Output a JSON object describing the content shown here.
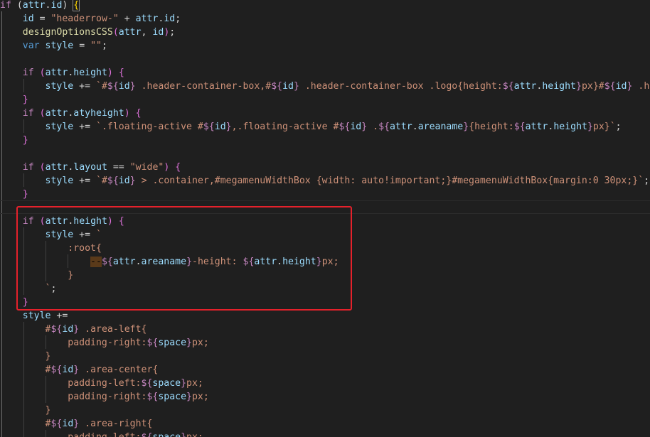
{
  "editor": {
    "colors": {
      "background": "#1f1f1f",
      "keyword": "#569cd6",
      "control": "#c586c0",
      "variable": "#9cdcfe",
      "function": "#dcdcaa",
      "string": "#ce9178",
      "punctuation": "#d4d4d4",
      "brace_level_1": "#ffd700",
      "brace_level_2": "#da70d6",
      "brace_level_3": "#179fff",
      "highlight_box": "#e5212b"
    },
    "lines": [
      [
        [
          "ctl",
          "if"
        ],
        [
          "punc",
          " ("
        ],
        [
          "var",
          "attr"
        ],
        [
          "punc",
          "."
        ],
        [
          "var",
          "id"
        ],
        [
          "punc",
          ") "
        ],
        [
          "brace1",
          "{"
        ]
      ],
      [
        [
          "punc",
          "    "
        ],
        [
          "var",
          "id"
        ],
        [
          "punc",
          " = "
        ],
        [
          "str",
          "\"headerrow-\""
        ],
        [
          "punc",
          " + "
        ],
        [
          "var",
          "attr"
        ],
        [
          "punc",
          "."
        ],
        [
          "var",
          "id"
        ],
        [
          "punc",
          ";"
        ]
      ],
      [
        [
          "punc",
          "    "
        ],
        [
          "fn",
          "designOptionsCSS"
        ],
        [
          "brace2",
          "("
        ],
        [
          "var",
          "attr"
        ],
        [
          "punc",
          ", "
        ],
        [
          "var",
          "id"
        ],
        [
          "brace2",
          ")"
        ],
        [
          "punc",
          ";"
        ]
      ],
      [
        [
          "punc",
          "    "
        ],
        [
          "kw",
          "var"
        ],
        [
          "punc",
          " "
        ],
        [
          "var",
          "style"
        ],
        [
          "punc",
          " = "
        ],
        [
          "str",
          "\"\""
        ],
        [
          "punc",
          ";"
        ]
      ],
      [],
      [
        [
          "punc",
          "    "
        ],
        [
          "ctl",
          "if"
        ],
        [
          "punc",
          " "
        ],
        [
          "brace2",
          "("
        ],
        [
          "var",
          "attr"
        ],
        [
          "punc",
          "."
        ],
        [
          "var",
          "height"
        ],
        [
          "brace2",
          ")"
        ],
        [
          "punc",
          " "
        ],
        [
          "brace2",
          "{"
        ]
      ],
      [
        [
          "punc",
          "        "
        ],
        [
          "var",
          "style"
        ],
        [
          "punc",
          " += "
        ],
        [
          "str",
          "`#"
        ],
        [
          "dollar",
          "${"
        ],
        [
          "var",
          "id"
        ],
        [
          "dollar",
          "}"
        ],
        [
          "str",
          " .header-container-box,#"
        ],
        [
          "dollar",
          "${"
        ],
        [
          "var",
          "id"
        ],
        [
          "dollar",
          "}"
        ],
        [
          "str",
          " .header-container-box .logo{height:"
        ],
        [
          "dollar",
          "${"
        ],
        [
          "var",
          "attr"
        ],
        [
          "punc",
          "."
        ],
        [
          "var",
          "height"
        ],
        [
          "dollar",
          "}"
        ],
        [
          "str",
          "px}#"
        ],
        [
          "dollar",
          "${"
        ],
        [
          "var",
          "id"
        ],
        [
          "dollar",
          "}"
        ],
        [
          "str",
          " .hover"
        ]
      ],
      [
        [
          "punc",
          "    "
        ],
        [
          "brace2",
          "}"
        ]
      ],
      [
        [
          "punc",
          "    "
        ],
        [
          "ctl",
          "if"
        ],
        [
          "punc",
          " "
        ],
        [
          "brace2",
          "("
        ],
        [
          "var",
          "attr"
        ],
        [
          "punc",
          "."
        ],
        [
          "var",
          "atyheight"
        ],
        [
          "brace2",
          ")"
        ],
        [
          "punc",
          " "
        ],
        [
          "brace2",
          "{"
        ]
      ],
      [
        [
          "punc",
          "        "
        ],
        [
          "var",
          "style"
        ],
        [
          "punc",
          " += "
        ],
        [
          "str",
          "`.floating-active #"
        ],
        [
          "dollar",
          "${"
        ],
        [
          "var",
          "id"
        ],
        [
          "dollar",
          "}"
        ],
        [
          "str",
          ",.floating-active #"
        ],
        [
          "dollar",
          "${"
        ],
        [
          "var",
          "id"
        ],
        [
          "dollar",
          "}"
        ],
        [
          "str",
          " ."
        ],
        [
          "dollar",
          "${"
        ],
        [
          "var",
          "attr"
        ],
        [
          "punc",
          "."
        ],
        [
          "var",
          "areaname"
        ],
        [
          "dollar",
          "}"
        ],
        [
          "str",
          "{height:"
        ],
        [
          "dollar",
          "${"
        ],
        [
          "var",
          "attr"
        ],
        [
          "punc",
          "."
        ],
        [
          "var",
          "height"
        ],
        [
          "dollar",
          "}"
        ],
        [
          "str",
          "px}`"
        ],
        [
          "punc",
          ";"
        ]
      ],
      [
        [
          "punc",
          "    "
        ],
        [
          "brace2",
          "}"
        ]
      ],
      [],
      [
        [
          "punc",
          "    "
        ],
        [
          "ctl",
          "if"
        ],
        [
          "punc",
          " "
        ],
        [
          "brace2",
          "("
        ],
        [
          "var",
          "attr"
        ],
        [
          "punc",
          "."
        ],
        [
          "var",
          "layout"
        ],
        [
          "punc",
          " == "
        ],
        [
          "str",
          "\"wide\""
        ],
        [
          "brace2",
          ")"
        ],
        [
          "punc",
          " "
        ],
        [
          "brace2",
          "{"
        ]
      ],
      [
        [
          "punc",
          "        "
        ],
        [
          "var",
          "style"
        ],
        [
          "punc",
          " += "
        ],
        [
          "str",
          "`#"
        ],
        [
          "dollar",
          "${"
        ],
        [
          "var",
          "id"
        ],
        [
          "dollar",
          "}"
        ],
        [
          "str",
          " > .container,#megamenuWidthBox {width: auto!important;}#megamenuWidthBox{margin:0 30px;}`"
        ],
        [
          "punc",
          ";"
        ]
      ],
      [
        [
          "punc",
          "    "
        ],
        [
          "brace2",
          "}"
        ]
      ],
      [],
      [
        [
          "punc",
          "    "
        ],
        [
          "ctl",
          "if"
        ],
        [
          "punc",
          " "
        ],
        [
          "brace2",
          "("
        ],
        [
          "var",
          "attr"
        ],
        [
          "punc",
          "."
        ],
        [
          "var",
          "height"
        ],
        [
          "brace2",
          ")"
        ],
        [
          "punc",
          " "
        ],
        [
          "brace2",
          "{"
        ]
      ],
      [
        [
          "punc",
          "        "
        ],
        [
          "var",
          "style"
        ],
        [
          "punc",
          " += "
        ],
        [
          "str",
          "`"
        ]
      ],
      [
        [
          "punc",
          "            "
        ],
        [
          "str",
          ":root{"
        ]
      ],
      [
        [
          "punc",
          "                "
        ],
        [
          "warn",
          "--"
        ],
        [
          "dollar",
          "${"
        ],
        [
          "var",
          "attr"
        ],
        [
          "punc",
          "."
        ],
        [
          "var",
          "areaname"
        ],
        [
          "dollar",
          "}"
        ],
        [
          "str",
          "-height: "
        ],
        [
          "dollar",
          "${"
        ],
        [
          "var",
          "attr"
        ],
        [
          "punc",
          "."
        ],
        [
          "var",
          "height"
        ],
        [
          "dollar",
          "}"
        ],
        [
          "str",
          "px;"
        ]
      ],
      [
        [
          "punc",
          "            "
        ],
        [
          "str",
          "}"
        ]
      ],
      [
        [
          "punc",
          "        "
        ],
        [
          "str",
          "`"
        ],
        [
          "punc",
          ";"
        ]
      ],
      [
        [
          "punc",
          "    "
        ],
        [
          "brace2",
          "}"
        ]
      ],
      [
        [
          "punc",
          "    "
        ],
        [
          "var",
          "style"
        ],
        [
          "punc",
          " +="
        ]
      ],
      [
        [
          "punc",
          "        "
        ],
        [
          "str",
          "#"
        ],
        [
          "dollar",
          "${"
        ],
        [
          "var",
          "id"
        ],
        [
          "dollar",
          "}"
        ],
        [
          "str",
          " .area-left{"
        ]
      ],
      [
        [
          "punc",
          "            "
        ],
        [
          "str",
          "padding-right:"
        ],
        [
          "dollar",
          "${"
        ],
        [
          "var",
          "space"
        ],
        [
          "dollar",
          "}"
        ],
        [
          "str",
          "px;"
        ]
      ],
      [
        [
          "punc",
          "        "
        ],
        [
          "str",
          "}"
        ]
      ],
      [
        [
          "punc",
          "        "
        ],
        [
          "str",
          "#"
        ],
        [
          "dollar",
          "${"
        ],
        [
          "var",
          "id"
        ],
        [
          "dollar",
          "}"
        ],
        [
          "str",
          " .area-center{"
        ]
      ],
      [
        [
          "punc",
          "            "
        ],
        [
          "str",
          "padding-left:"
        ],
        [
          "dollar",
          "${"
        ],
        [
          "var",
          "space"
        ],
        [
          "dollar",
          "}"
        ],
        [
          "str",
          "px;"
        ]
      ],
      [
        [
          "punc",
          "            "
        ],
        [
          "str",
          "padding-right:"
        ],
        [
          "dollar",
          "${"
        ],
        [
          "var",
          "space"
        ],
        [
          "dollar",
          "}"
        ],
        [
          "str",
          "px;"
        ]
      ],
      [
        [
          "punc",
          "        "
        ],
        [
          "str",
          "}"
        ]
      ],
      [
        [
          "punc",
          "        "
        ],
        [
          "str",
          "#"
        ],
        [
          "dollar",
          "${"
        ],
        [
          "var",
          "id"
        ],
        [
          "dollar",
          "}"
        ],
        [
          "str",
          " .area-right{"
        ]
      ],
      [
        [
          "punc",
          "            "
        ],
        [
          "str",
          "padding-left:"
        ],
        [
          "dollar",
          "${"
        ],
        [
          "var",
          "space"
        ],
        [
          "dollar",
          "}"
        ],
        [
          "str",
          "px;"
        ]
      ]
    ]
  }
}
